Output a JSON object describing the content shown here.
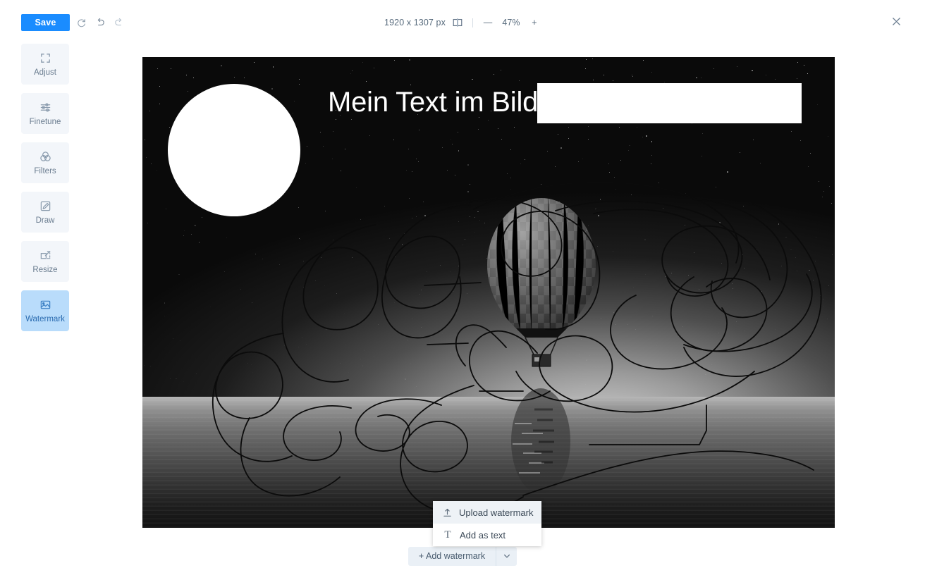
{
  "toolbar": {
    "save_label": "Save",
    "reset_icon": "reset-icon",
    "undo_icon": "undo-icon",
    "redo_icon": "redo-icon",
    "dimensions": "1920 x 1307 px",
    "compare_icon": "split-compare-icon",
    "zoom_out_label": "—",
    "zoom_level": "47%",
    "zoom_in_label": "+",
    "close_icon": "close-icon",
    "accent_color": "#1a8cff"
  },
  "sidebar": {
    "items": [
      {
        "label": "Adjust",
        "icon": "crop-icon",
        "active": false
      },
      {
        "label": "Finetune",
        "icon": "sliders-icon",
        "active": false
      },
      {
        "label": "Filters",
        "icon": "venn-icon",
        "active": false
      },
      {
        "label": "Draw",
        "icon": "pencil-icon",
        "active": false
      },
      {
        "label": "Resize",
        "icon": "resize-icon",
        "active": false
      },
      {
        "label": "Watermark",
        "icon": "image-icon",
        "active": true
      }
    ],
    "active_bg": "#b9dcfb",
    "inactive_bg": "#f3f6fa"
  },
  "canvas": {
    "watermark_text": "Mein Text im Bild",
    "image_description": "night-sky-hot-air-balloon-over-water",
    "overlays": [
      "white-circle-watermark",
      "white-rectangle-watermark",
      "text-watermark",
      "freehand-scribble"
    ]
  },
  "bottom": {
    "add_watermark_label": "+ Add watermark",
    "dropdown_arrow_icon": "chevron-down-icon"
  },
  "menu": {
    "items": [
      {
        "label": "Upload watermark",
        "icon": "upload-icon",
        "hover": true
      },
      {
        "label": "Add as text",
        "icon": "text-t-icon",
        "hover": false
      }
    ]
  }
}
